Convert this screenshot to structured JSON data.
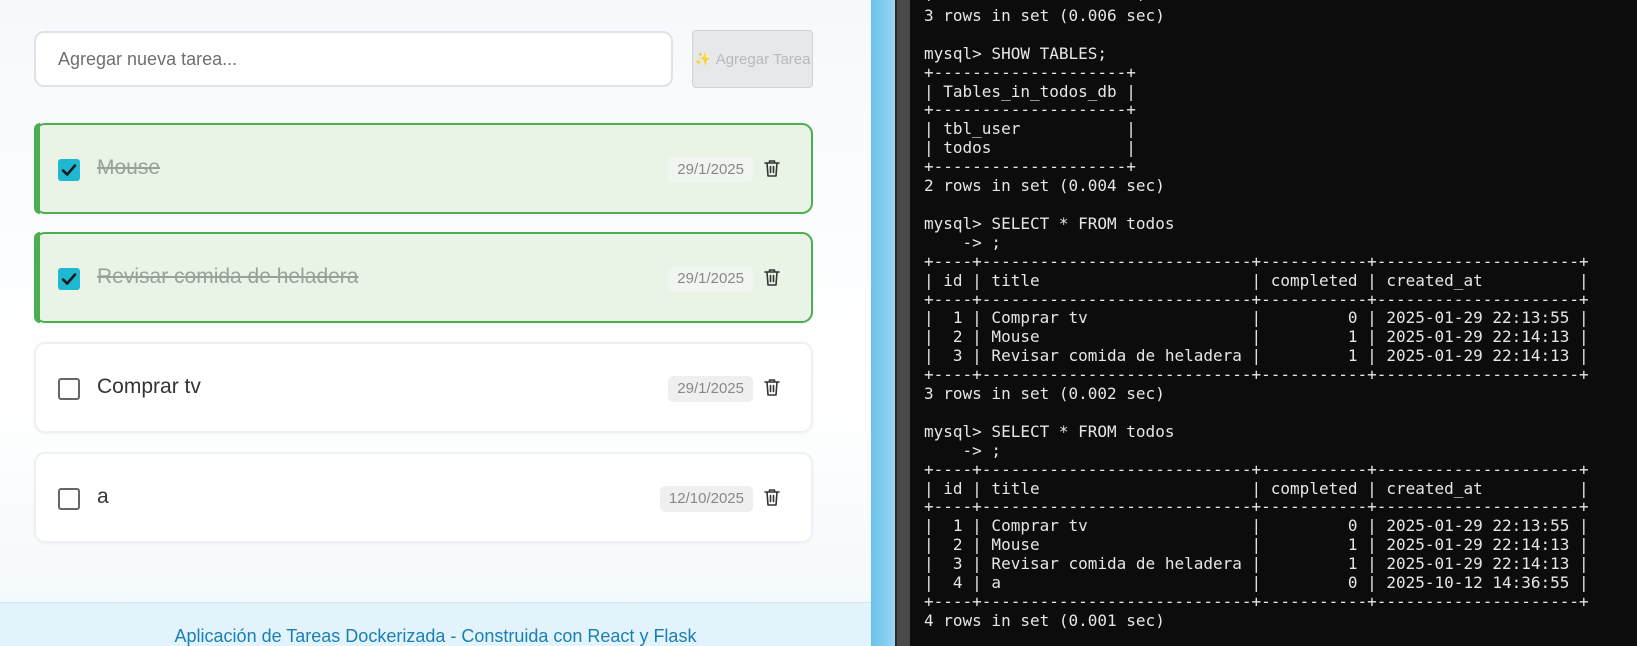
{
  "app": {
    "input_placeholder": "Agregar nueva tarea...",
    "add_button_label": "Agregar Tarea",
    "add_button_icon": "sparkles-icon",
    "tasks": [
      {
        "title": "Mouse",
        "date": "29/1/2025",
        "completed": true
      },
      {
        "title": "Revisar comida de heladera",
        "date": "29/1/2025",
        "completed": true
      },
      {
        "title": "Comprar tv",
        "date": "29/1/2025",
        "completed": false
      },
      {
        "title": "a",
        "date": "12/10/2025",
        "completed": false
      }
    ],
    "footer_text": "Aplicación de Tareas Dockerizada - Construida con React y Flask",
    "colors": {
      "accent_done": "#4cae4f",
      "checkbox": "#1fb8d2",
      "footer_text": "#1a7fb2"
    }
  },
  "terminal": {
    "lines": [
      "+---------------------+",
      "3 rows in set (0.006 sec)",
      "",
      "mysql> SHOW TABLES;",
      "+--------------------+",
      "| Tables_in_todos_db |",
      "+--------------------+",
      "| tbl_user           |",
      "| todos              |",
      "+--------------------+",
      "2 rows in set (0.004 sec)",
      "",
      "mysql> SELECT * FROM todos",
      "    -> ;",
      "+----+----------------------------+-----------+---------------------+",
      "| id | title                      | completed | created_at          |",
      "+----+----------------------------+-----------+---------------------+",
      "|  1 | Comprar tv                 |         0 | 2025-01-29 22:13:55 |",
      "|  2 | Mouse                      |         1 | 2025-01-29 22:14:13 |",
      "|  3 | Revisar comida de heladera |         1 | 2025-01-29 22:14:13 |",
      "+----+----------------------------+-----------+---------------------+",
      "3 rows in set (0.002 sec)",
      "",
      "mysql> SELECT * FROM todos",
      "    -> ;",
      "+----+----------------------------+-----------+---------------------+",
      "| id | title                      | completed | created_at          |",
      "+----+----------------------------+-----------+---------------------+",
      "|  1 | Comprar tv                 |         0 | 2025-01-29 22:13:55 |",
      "|  2 | Mouse                      |         1 | 2025-01-29 22:14:13 |",
      "|  3 | Revisar comida de heladera |         1 | 2025-01-29 22:14:13 |",
      "|  4 | a                          |         0 | 2025-10-12 14:36:55 |",
      "+----+----------------------------+-----------+---------------------+",
      "4 rows in set (0.001 sec)"
    ]
  }
}
